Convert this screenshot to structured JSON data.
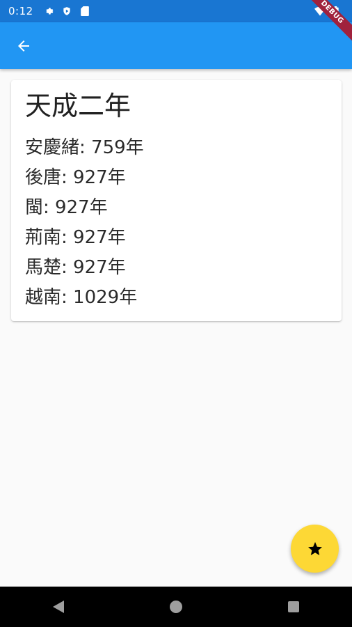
{
  "status_bar": {
    "time": "0:12",
    "icons_left": [
      "gear-icon",
      "play-shield-icon",
      "sd-card-icon"
    ],
    "icons_right": [
      "wifi-icon",
      "battery-icon"
    ]
  },
  "debug_banner": {
    "label": "DEBUG",
    "color": "#a0223d"
  },
  "app_bar": {
    "color": "#2196f3",
    "back_icon": "arrow-back-icon"
  },
  "card": {
    "title": "天成二年",
    "items": [
      "安慶緒: 759年",
      "後唐: 927年",
      "閩: 927年",
      "荊南: 927年",
      "馬楚: 927年",
      "越南: 1029年"
    ]
  },
  "fab": {
    "icon": "star-icon",
    "color": "#fdd835"
  },
  "nav_bar": {
    "buttons": [
      "back-triangle-icon",
      "home-circle-icon",
      "recents-square-icon"
    ]
  }
}
